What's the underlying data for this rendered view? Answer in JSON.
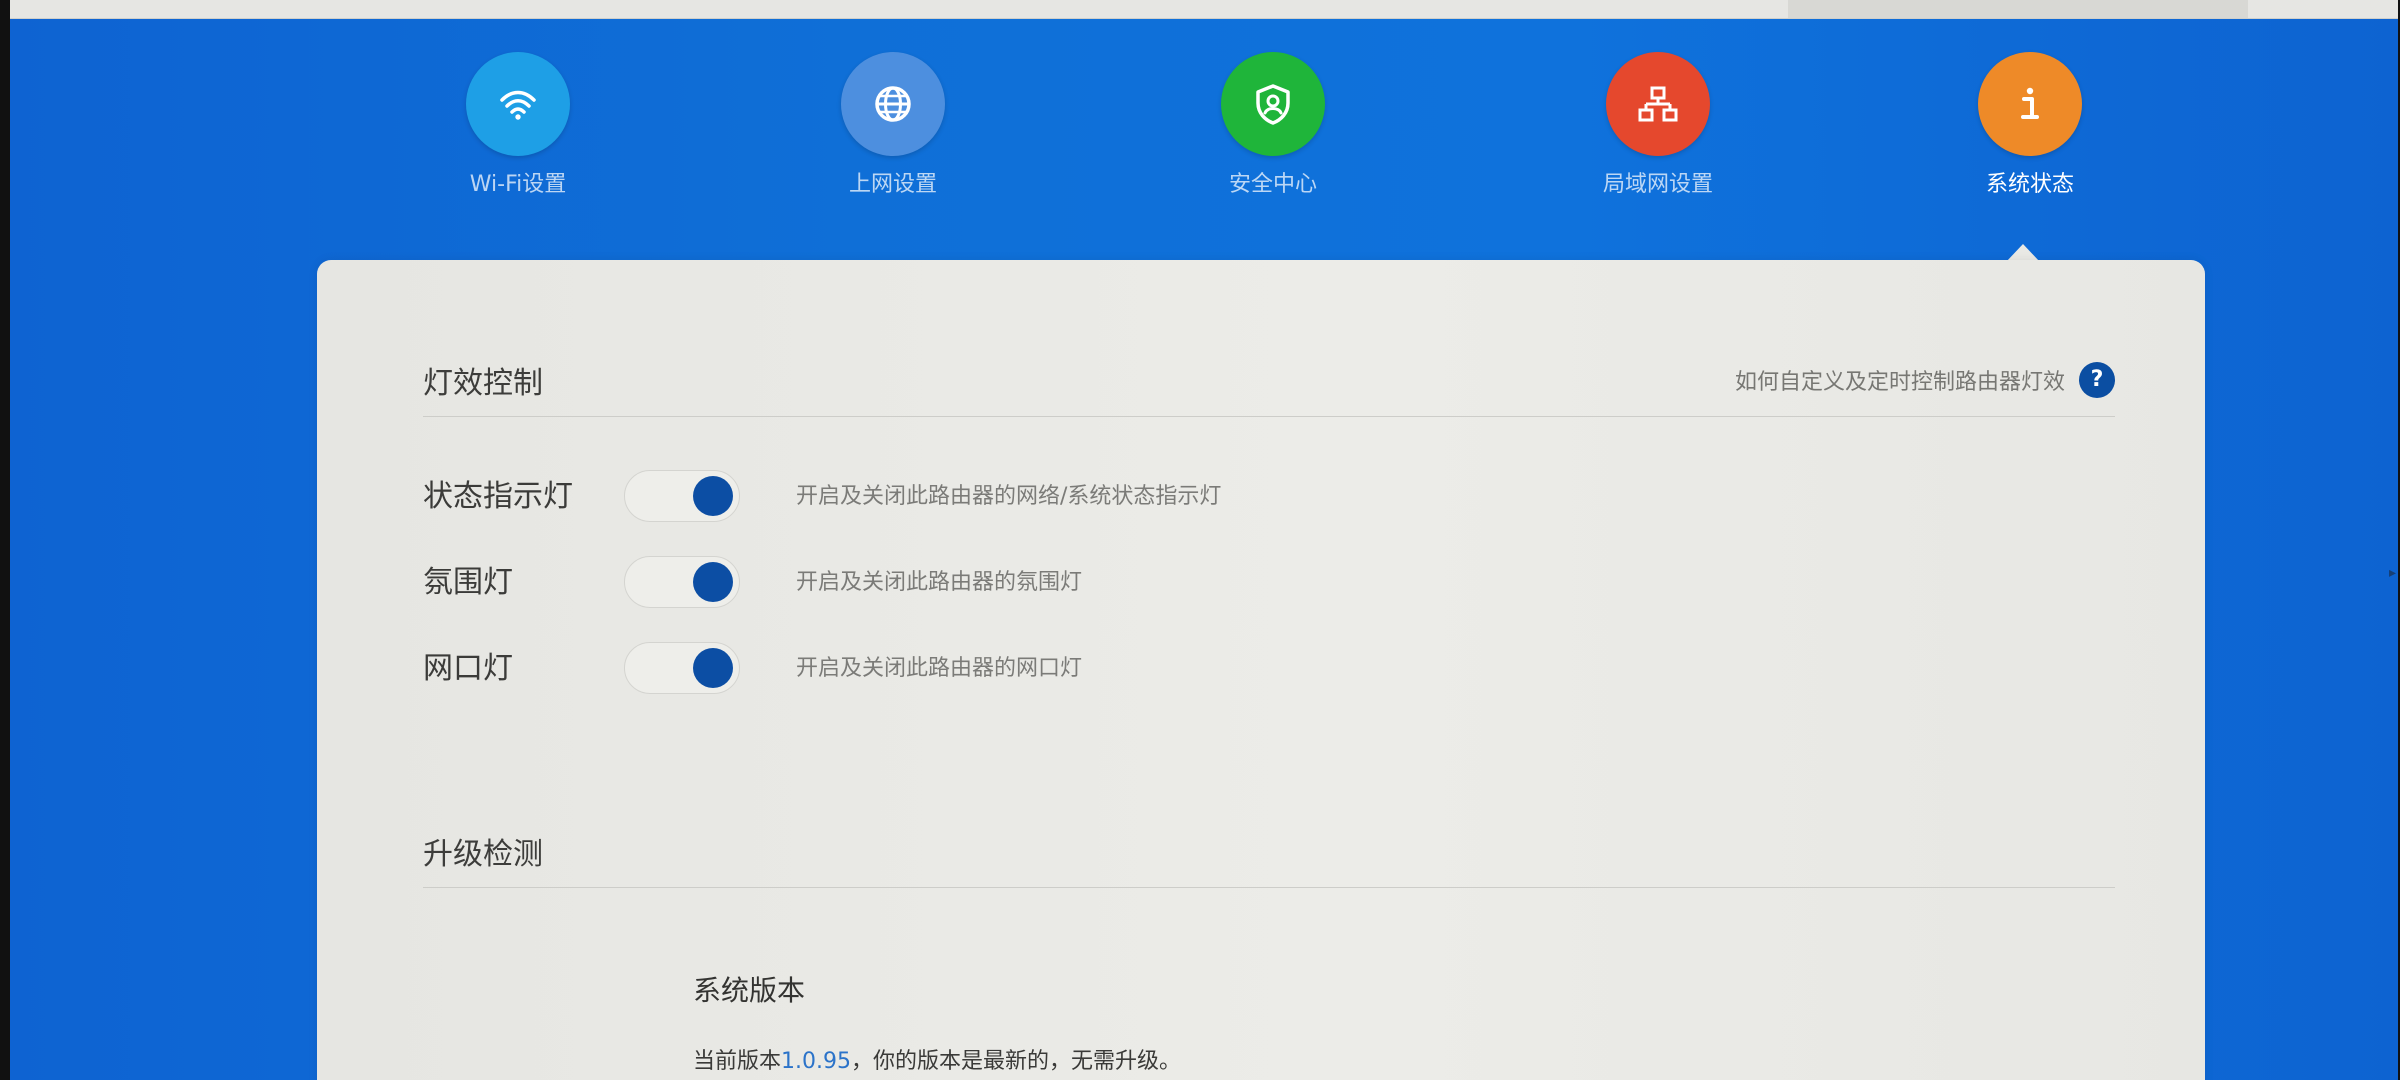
{
  "colors": {
    "background_blue": "#0f6fd7",
    "panel": "#ebebe7",
    "toggle_knob": "#0c4ea4",
    "wifi_icon_bg": "#1e9fe6",
    "internet_icon_bg": "#4d8fdf",
    "security_icon_bg": "#1fb53a",
    "lan_icon_bg": "#e5482d",
    "status_icon_bg": "#ee8a28"
  },
  "nav": {
    "items": [
      {
        "label": "Wi-Fi设置",
        "icon": "wifi-icon",
        "active": false
      },
      {
        "label": "上网设置",
        "icon": "globe-icon",
        "active": false
      },
      {
        "label": "安全中心",
        "icon": "shield-icon",
        "active": false
      },
      {
        "label": "局域网设置",
        "icon": "network-icon",
        "active": false
      },
      {
        "label": "系统状态",
        "icon": "info-icon",
        "active": true
      }
    ]
  },
  "light_control": {
    "title": "灯效控制",
    "help_text": "如何自定义及定时控制路由器灯效",
    "help_icon_text": "?",
    "rows": [
      {
        "label": "状态指示灯",
        "enabled": true,
        "description": "开启及关闭此路由器的网络/系统状态指示灯"
      },
      {
        "label": "氛围灯",
        "enabled": true,
        "description": "开启及关闭此路由器的氛围灯"
      },
      {
        "label": "网口灯",
        "enabled": true,
        "description": "开启及关闭此路由器的网口灯"
      }
    ]
  },
  "upgrade": {
    "title": "升级检测",
    "version_title": "系统版本",
    "version_prefix": "当前版本",
    "version_number": "1.0.95",
    "version_suffix": "，你的版本是最新的，无需升级。"
  },
  "misc": {
    "right_edge_mark": "▸"
  }
}
